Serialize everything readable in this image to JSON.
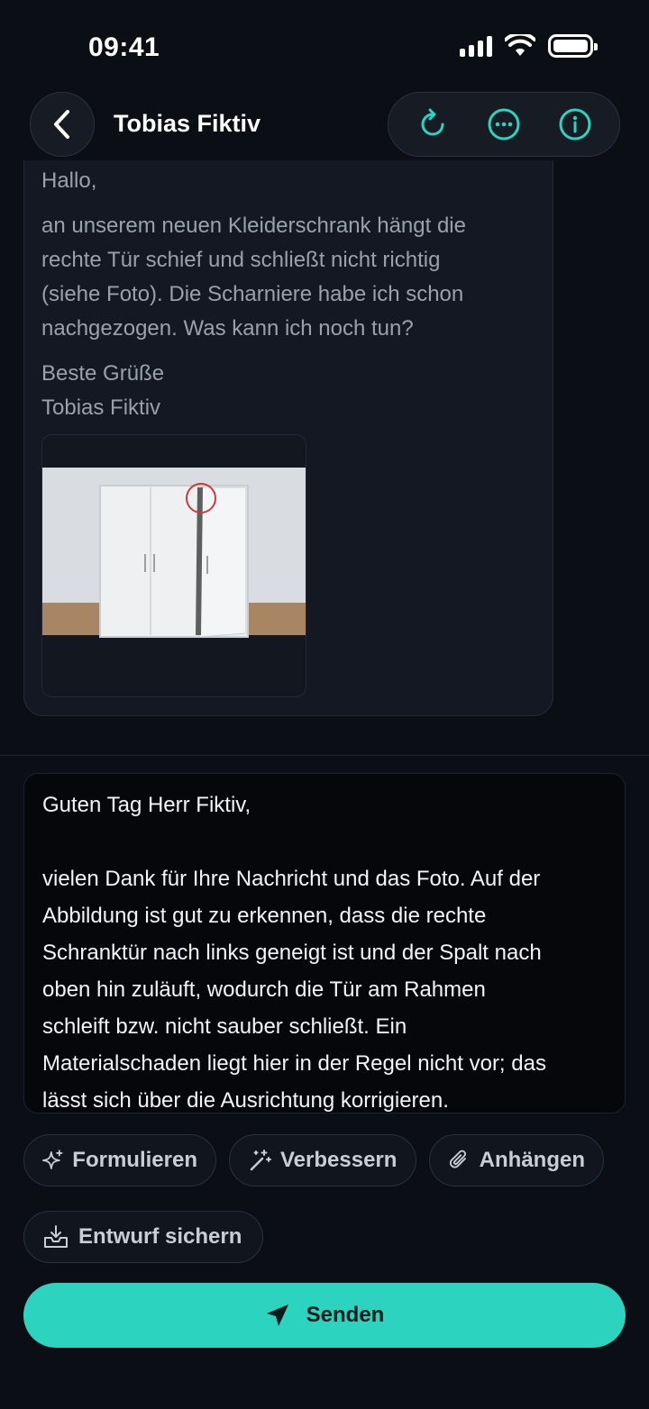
{
  "status_bar": {
    "time": "09:41"
  },
  "header": {
    "back_icon": "chevron-left-icon",
    "title": "Tobias Fiktiv",
    "actions": [
      "refresh-icon",
      "more-icon",
      "info-icon"
    ],
    "accent": "#2cd3bf"
  },
  "message": {
    "greeting": "Hallo,",
    "body_lines": [
      "an unserem neuen Kleiderschrank hängt die",
      "rechte Tür schief und schließt nicht richtig",
      "(siehe Foto). Die Scharniere habe ich schon",
      "nachgezogen. Was kann ich noch tun?"
    ],
    "closing": "Beste Grüße",
    "signature": "Tobias Fiktiv",
    "attachment": "wardrobe-photo"
  },
  "reply": {
    "salutation": "Guten Tag Herr Fiktiv,",
    "lines": [
      "vielen Dank für Ihre Nachricht und das Foto. Auf der",
      "Abbildung ist gut zu erkennen, dass die rechte",
      "Schranktür nach links geneigt ist und der Spalt nach",
      "oben hin zuläuft, wodurch die Tür am Rahmen",
      "schleift bzw. nicht sauber schließt. Ein",
      "Materialschaden liegt hier in der Regel nicht vor; das",
      "lässt sich über die Ausrichtung korrigieren."
    ]
  },
  "tools": {
    "formulate": "Formulieren",
    "improve": "Verbessern",
    "attach": "Anhängen",
    "save_draft": "Entwurf sichern"
  },
  "send_label": "Senden"
}
